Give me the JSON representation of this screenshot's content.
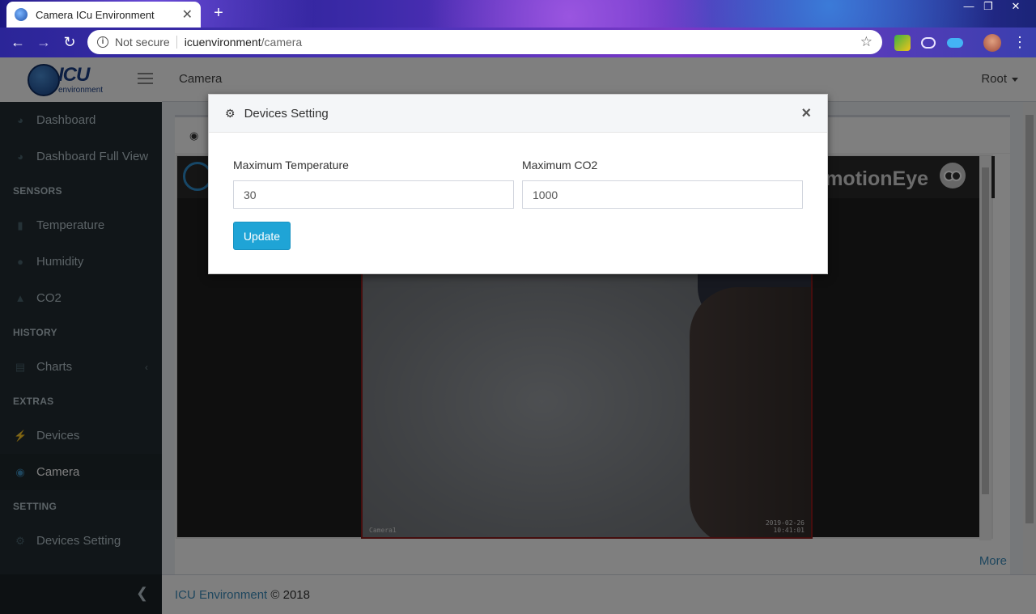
{
  "browser": {
    "tab_title": "Camera ICu Environment",
    "tab_close": "✕",
    "new_tab": "+",
    "security": "Not secure",
    "url_host": "icuenvironment",
    "url_path": "/camera",
    "window_min": "—",
    "window_restore": "❐",
    "window_close": "✕"
  },
  "header": {
    "logo_text": "ICU",
    "logo_sub": "environment",
    "title": "Camera",
    "user": "Root"
  },
  "sidebar": {
    "items": [
      {
        "label": "Dashboard",
        "icon": "dashboard-icon"
      },
      {
        "label": "Dashboard Full View",
        "icon": "dashboard-icon"
      },
      {
        "label": "Temperature",
        "icon": "thermometer-icon"
      },
      {
        "label": "Humidity",
        "icon": "droplet-icon"
      },
      {
        "label": "CO2",
        "icon": "flask-icon"
      },
      {
        "label": "Charts",
        "icon": "bar-chart-icon"
      },
      {
        "label": "Devices",
        "icon": "plug-icon"
      },
      {
        "label": "Camera",
        "icon": "camera-icon"
      },
      {
        "label": "Devices Setting",
        "icon": "gear-icon"
      }
    ],
    "headers": [
      "SENSORS",
      "HISTORY",
      "EXTRAS",
      "SETTING"
    ],
    "active": "Camera"
  },
  "camera": {
    "brand": "motionEye",
    "overlay_name": "Camera1",
    "overlay_date": "2019-02-26",
    "overlay_time": "10:41:01",
    "more_link": "More"
  },
  "footer": {
    "link": "ICU Environment",
    "text": " © 2018"
  },
  "modal": {
    "title": "Devices Setting",
    "close": "×",
    "max_temp_label": "Maximum Temperature",
    "max_temp_value": "30",
    "max_co2_label": "Maximum CO2",
    "max_co2_value": "1000",
    "update_button": "Update"
  },
  "colors": {
    "sidebar_bg": "#222d32",
    "accent": "#3c8dbc",
    "button": "#1fa4d6"
  }
}
